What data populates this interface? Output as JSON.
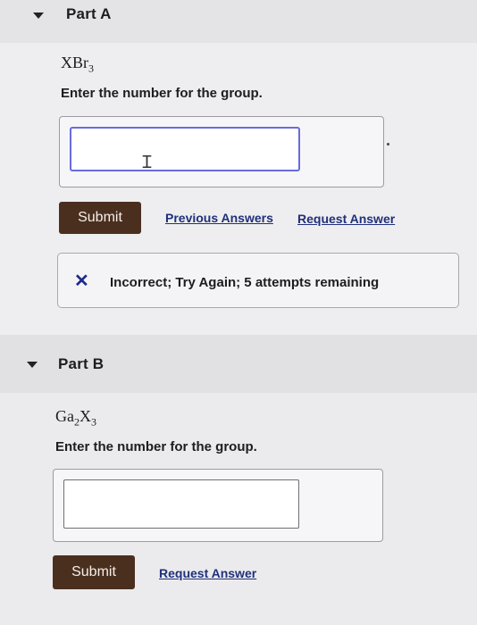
{
  "part_a": {
    "title": "Part A",
    "formula_main": "XBr",
    "formula_sub": "3",
    "prompt": "Enter the number for the group.",
    "input_value": "",
    "submit_label": "Submit",
    "previous_answers_label": "Previous Answers",
    "request_answer_label": "Request Answer",
    "feedback": {
      "icon": "x-icon",
      "text": "Incorrect; Try Again; 5 attempts remaining"
    }
  },
  "part_b": {
    "title": "Part B",
    "formula_el1": "Ga",
    "formula_sub1": "2",
    "formula_el2": "X",
    "formula_sub2": "3",
    "prompt": "Enter the number for the group.",
    "input_value": "",
    "submit_label": "Submit",
    "request_answer_label": "Request Answer"
  },
  "colors": {
    "submit_bg": "#4a2f1f",
    "link": "#20307a",
    "input_focus_border": "#6a6ae0",
    "incorrect_icon": "#1c2a8a"
  }
}
